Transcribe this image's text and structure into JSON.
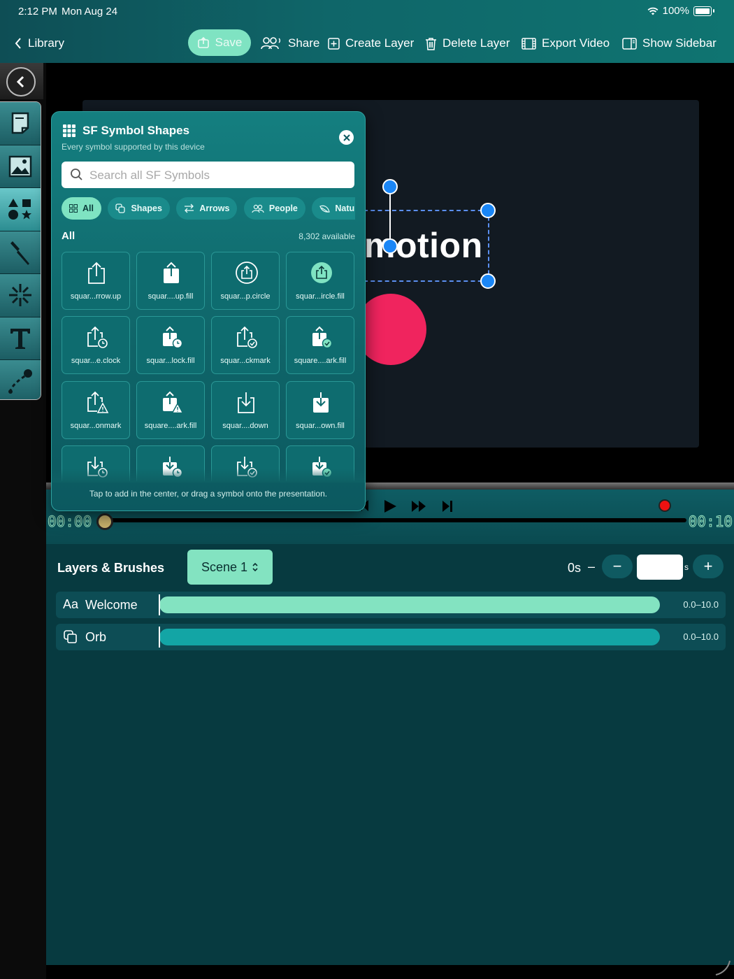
{
  "status": {
    "time": "2:12 PM",
    "date": "Mon Aug 24",
    "battery": "100%"
  },
  "toolbar": {
    "back_label": "Library",
    "save_label": "Save",
    "share_label": "Share",
    "create_layer_label": "Create Layer",
    "delete_layer_label": "Delete Layer",
    "export_video_label": "Export Video",
    "show_sidebar_label": "Show Sidebar"
  },
  "rail": {
    "tools": [
      "page-icon",
      "image-icon",
      "shapes-icon",
      "brush-icon",
      "sparkle-icon",
      "text-icon",
      "path-icon"
    ],
    "selected": "shapes-icon"
  },
  "canvas": {
    "text": "motion",
    "orb_color": "#f0245e",
    "background": "#121a22"
  },
  "transport": {
    "start_time": "00:00",
    "end_time": "00:10"
  },
  "layers": {
    "title": "Layers & Brushes",
    "scene_label": "Scene 1",
    "duration_label": "0s",
    "duration_dash": "–",
    "duration_unit": "s",
    "minus": "−",
    "plus": "+",
    "rows": [
      {
        "icon": "Aa",
        "name": "Welcome",
        "range": "0.0–10.0",
        "bar_color": "#83e3c1"
      },
      {
        "icon": "shape-layer-icon",
        "name": "Orb",
        "range": "0.0–10.0",
        "bar_color": "#13a5a5"
      }
    ]
  },
  "symbol_panel": {
    "title": "SF Symbol Shapes",
    "subtitle": "Every symbol supported by this device",
    "search_placeholder": "Search all SF Symbols",
    "chips": [
      {
        "label": "All",
        "icon": "grid-icon",
        "selected": true
      },
      {
        "label": "Shapes",
        "icon": "shapes-icon",
        "selected": false
      },
      {
        "label": "Arrows",
        "icon": "arrows-icon",
        "selected": false
      },
      {
        "label": "People",
        "icon": "people-icon",
        "selected": false
      },
      {
        "label": "Natur",
        "icon": "nature-icon",
        "selected": false
      }
    ],
    "section_label": "All",
    "section_count": "8,302 available",
    "symbols": [
      "squar...rrow.up",
      "squar....up.fill",
      "squar...p.circle",
      "squar...ircle.fill",
      "squar...e.clock",
      "squar...lock.fill",
      "squar...ckmark",
      "square....ark.fill",
      "squar...onmark",
      "square....ark.fill",
      "squar....down",
      "squar...own.fill",
      "",
      "",
      "",
      ""
    ],
    "hint": "Tap to add in the center, or drag a symbol onto the presentation."
  },
  "colors": {
    "accent": "#83e3c1",
    "handle": "#1a86f6",
    "panel": "#0f6468"
  }
}
